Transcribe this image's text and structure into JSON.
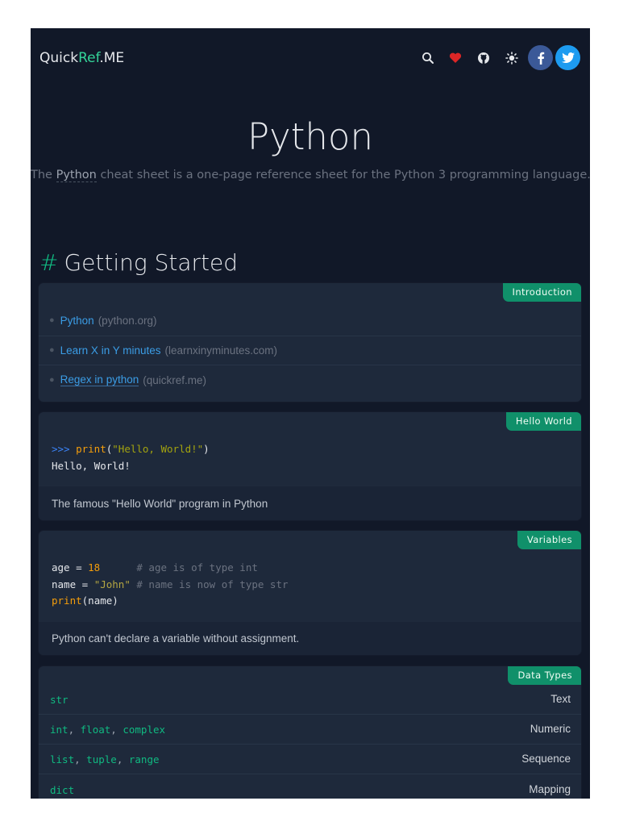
{
  "header": {
    "logo_part1": "Quick",
    "logo_part2": "Ref",
    "logo_part3": ".ME"
  },
  "hero": {
    "title": "Python",
    "desc_prefix": "The ",
    "desc_keyword": "Python",
    "desc_suffix": " cheat sheet is a one-page reference sheet for the Python 3 programming language."
  },
  "section": {
    "hash": "#",
    "title": "Getting Started"
  },
  "intro_card": {
    "tag": "Introduction",
    "links": [
      {
        "label": "Python",
        "note": "(python.org)"
      },
      {
        "label": "Learn X in Y minutes",
        "note": "(learnxinyminutes.com)"
      },
      {
        "label": "Regex in python",
        "note": "(quickref.me)"
      }
    ]
  },
  "hello_card": {
    "tag": "Hello World",
    "prompt": ">>> ",
    "fn": "print",
    "open": "(",
    "str": "\"Hello, World!\"",
    "close": ")",
    "output": "Hello, World!",
    "footer": "The famous \"Hello World\" program in Python"
  },
  "vars_card": {
    "tag": "Variables",
    "line1_code": "age = ",
    "line1_num": "18",
    "line1_comment": "      # age is of type int",
    "line2_code": "name = ",
    "line2_str": "\"John\"",
    "line2_comment": " # name is now of type str",
    "line3_fn": "print",
    "line3_rest": "(name)",
    "footer": "Python can't declare a variable without assignment."
  },
  "types_card": {
    "tag": "Data Types",
    "rows": [
      {
        "code": [
          "str"
        ],
        "value": "Text"
      },
      {
        "code": [
          "int",
          "float",
          "complex"
        ],
        "value": "Numeric"
      },
      {
        "code": [
          "list",
          "tuple",
          "range"
        ],
        "value": "Sequence"
      },
      {
        "code": [
          "dict"
        ],
        "value": "Mapping"
      }
    ]
  }
}
